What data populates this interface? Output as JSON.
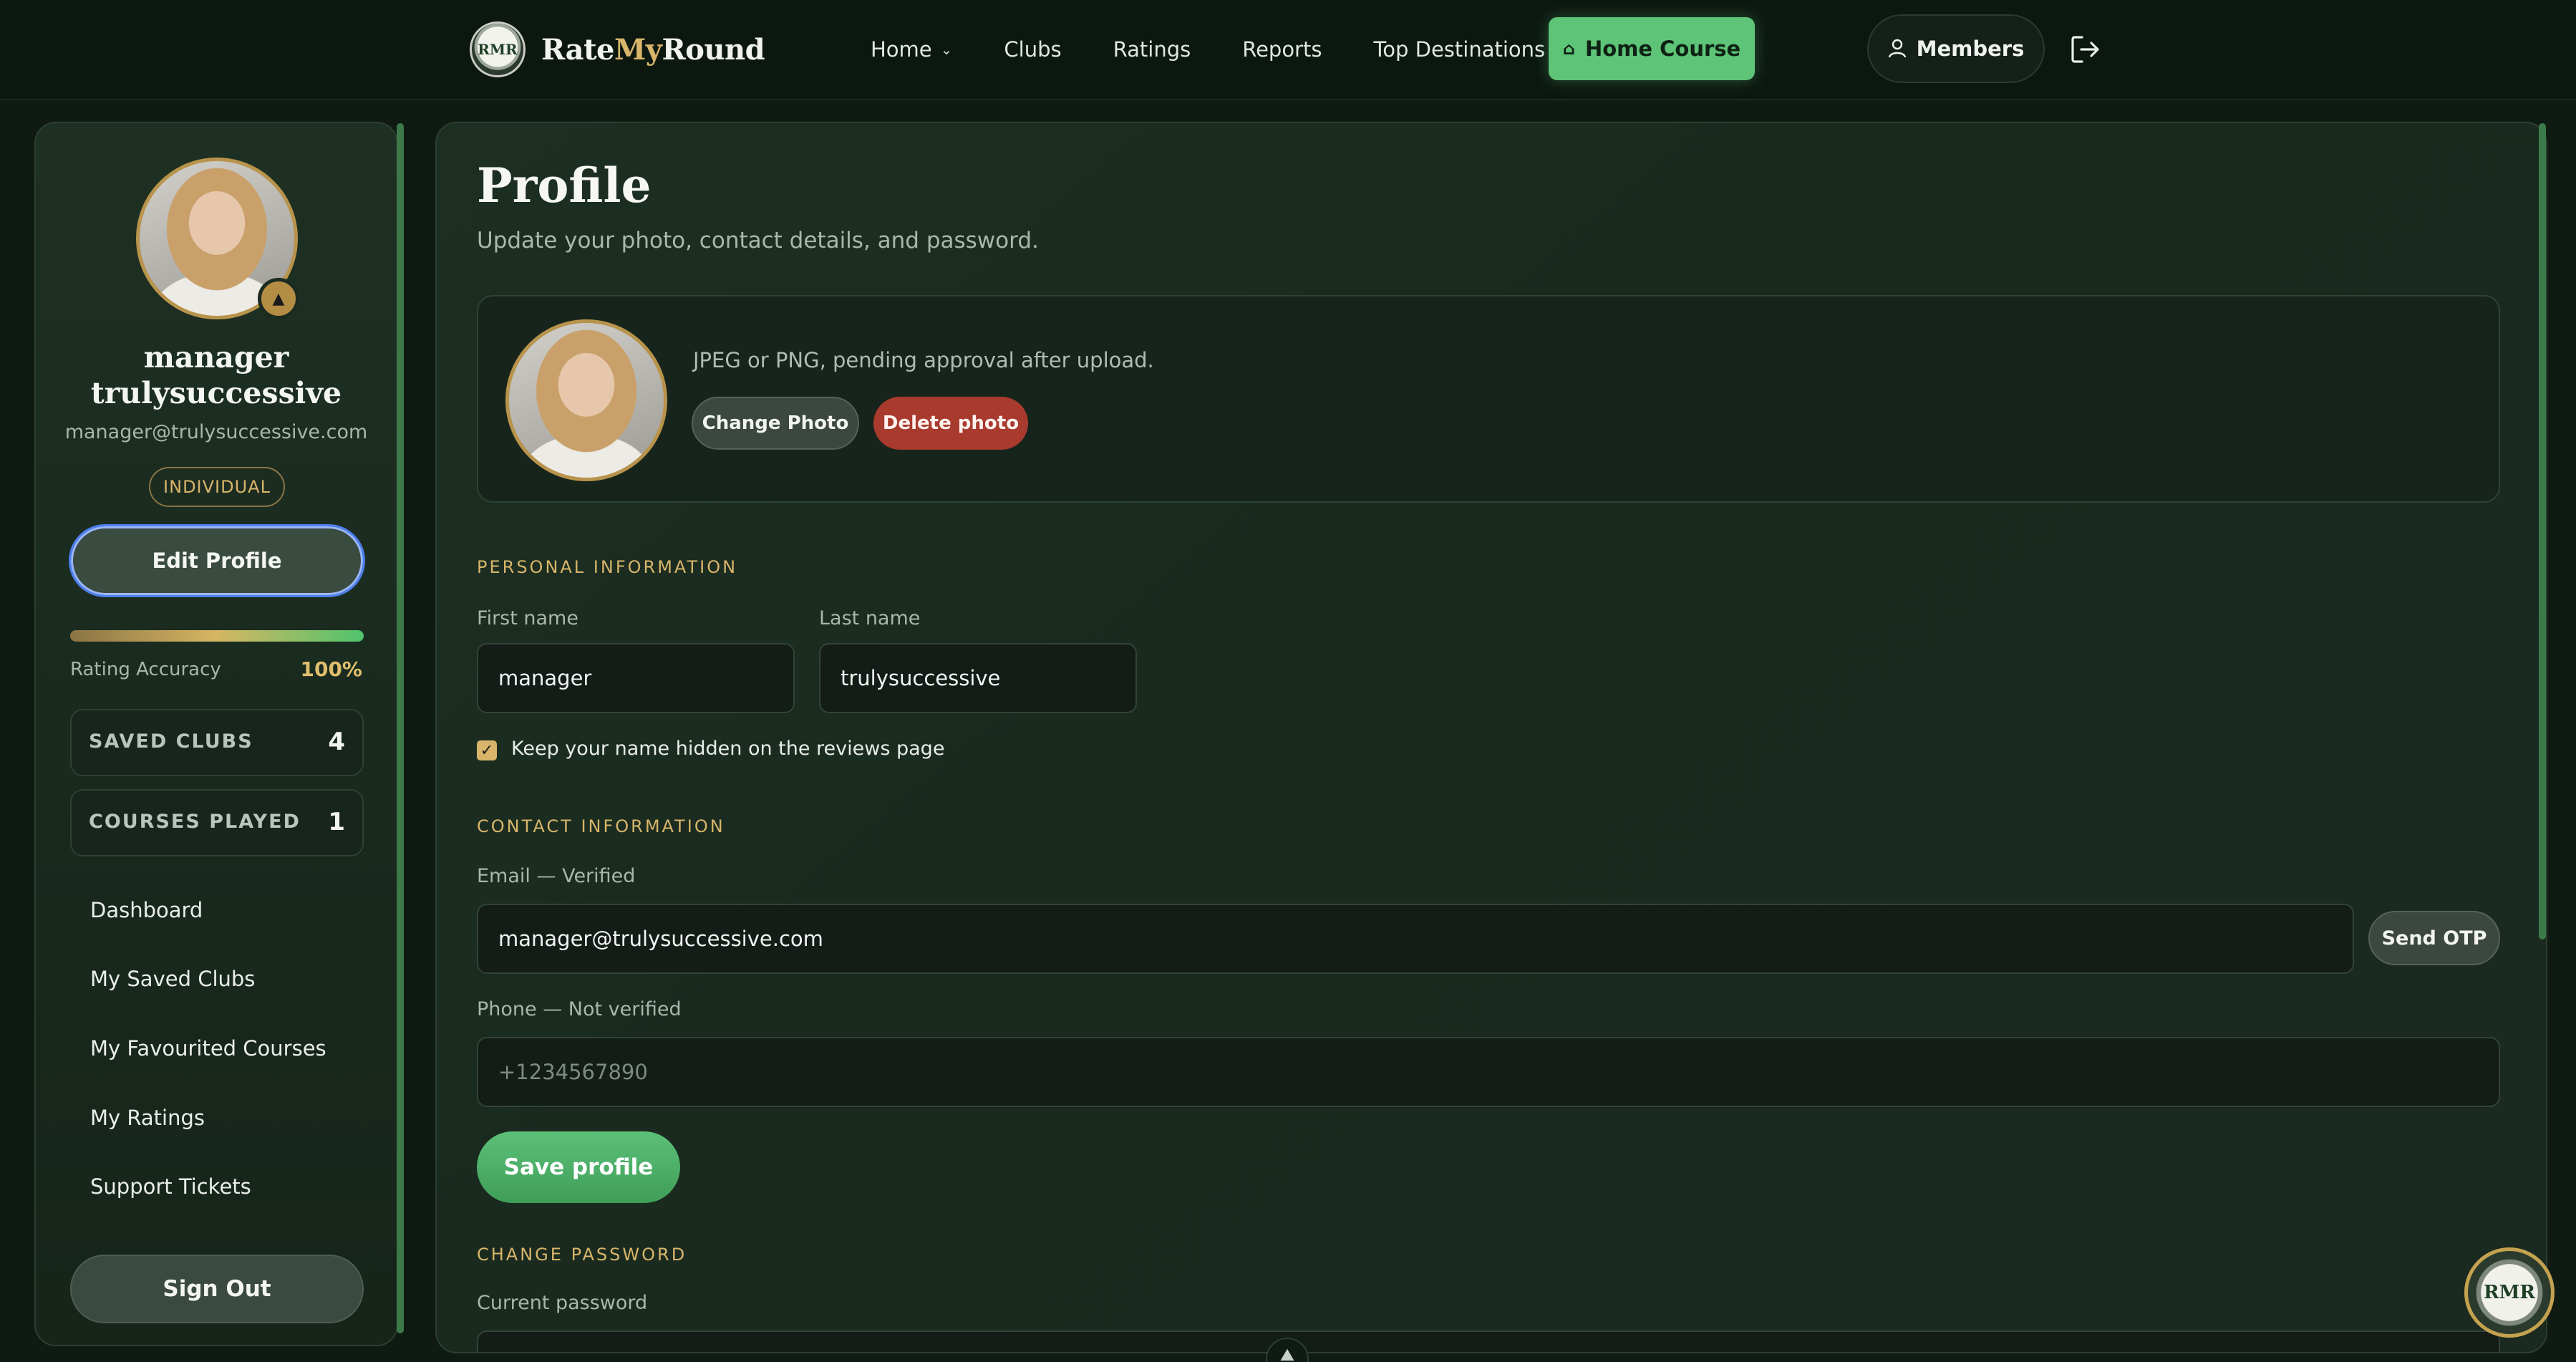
{
  "brand": {
    "logo_text": "RMR",
    "name_part1": "Rate",
    "name_part2": "My",
    "name_part3": "Round"
  },
  "nav": {
    "items": [
      {
        "label": "Home",
        "dropdown": true
      },
      {
        "label": "Clubs",
        "dropdown": false
      },
      {
        "label": "Ratings",
        "dropdown": false
      },
      {
        "label": "Reports",
        "dropdown": false
      },
      {
        "label": "Top Destinations",
        "dropdown": true
      }
    ],
    "home_course_label": "Home Course",
    "members_label": "Members"
  },
  "sidebar": {
    "name": "manager trulysuccessive",
    "email": "manager@trulysuccessive.com",
    "badge": "INDIVIDUAL",
    "edit_profile_label": "Edit Profile",
    "accuracy_label": "Rating Accuracy",
    "accuracy_value": "100%",
    "accuracy_fraction": 1.0,
    "stats": [
      {
        "label": "SAVED CLUBS",
        "value": "4"
      },
      {
        "label": "COURSES PLAYED",
        "value": "1"
      }
    ],
    "menu": [
      {
        "label": "Dashboard"
      },
      {
        "label": "My Saved Clubs"
      },
      {
        "label": "My Favourited Courses"
      },
      {
        "label": "My Ratings"
      },
      {
        "label": "Support Tickets"
      }
    ],
    "sign_out_label": "Sign Out"
  },
  "main": {
    "title": "Profile",
    "subtitle": "Update your photo, contact details, and password.",
    "photo": {
      "hint": "JPEG or PNG, pending approval after upload.",
      "change_label": "Change Photo",
      "delete_label": "Delete photo"
    },
    "personal": {
      "heading": "PERSONAL INFORMATION",
      "first_name_label": "First name",
      "first_name_value": "manager",
      "last_name_label": "Last name",
      "last_name_value": "trulysuccessive",
      "hide_name_label": "Keep your name hidden on the reviews page",
      "hide_name_checked": true
    },
    "contact": {
      "heading": "CONTACT INFORMATION",
      "email_label": "Email — Verified",
      "email_value": "manager@trulysuccessive.com",
      "send_otp_label": "Send OTP",
      "phone_label": "Phone — Not verified",
      "phone_placeholder": "+1234567890"
    },
    "save_label": "Save profile",
    "password": {
      "heading": "CHANGE PASSWORD",
      "current_label": "Current password"
    }
  },
  "float_logo_text": "RMR",
  "colors": {
    "accent_green": "#5ec477",
    "gold": "#d8b56a",
    "danger": "#a83a2e",
    "focus_blue": "#4d7ff0"
  }
}
